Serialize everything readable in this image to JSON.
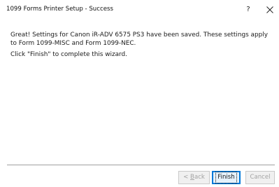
{
  "window": {
    "title": "1099 Forms Printer Setup - Success",
    "help_label": "?",
    "close_icon": "close-icon"
  },
  "content": {
    "message": "Great! Settings for Canon iR-ADV 6575 PS3 have been saved. These settings apply to Form 1099-MISC and Form 1099-NEC.",
    "instruction": "Click \"Finish\" to complete this wizard."
  },
  "buttons": {
    "back_prefix": "< ",
    "back_mnemonic": "B",
    "back_suffix": "ack",
    "back_enabled": false,
    "finish_label": "Finish",
    "finish_default": true,
    "cancel_label": "Cancel",
    "cancel_enabled": false
  },
  "colors": {
    "accent": "#0078d7",
    "disabled_text": "#a3a3a3",
    "button_face": "#e1e1e1"
  }
}
